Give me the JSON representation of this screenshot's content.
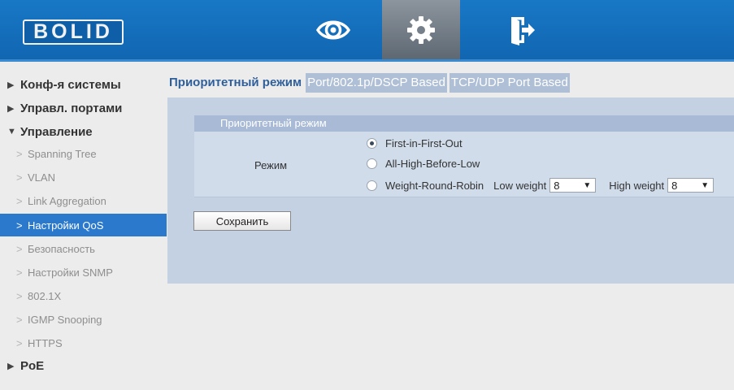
{
  "header": {
    "logo_text": "BOLID",
    "nav": [
      {
        "icon": "eye-icon"
      },
      {
        "icon": "gear-icon",
        "active": true
      },
      {
        "icon": "logout-icon"
      }
    ],
    "accent": "#1670bd"
  },
  "sidebar": {
    "groups": [
      {
        "arrow": "▶",
        "label": "Конф-я системы"
      },
      {
        "arrow": "▶",
        "label": "Управл. портами"
      },
      {
        "arrow": "▼",
        "label": "Управление"
      },
      {
        "arrow": "▶",
        "label": "PoE"
      }
    ],
    "items": [
      {
        "label": "Spanning Tree"
      },
      {
        "label": "VLAN"
      },
      {
        "label": "Link Aggregation"
      },
      {
        "label": "Настройки QoS",
        "active": true
      },
      {
        "label": "Безопасность"
      },
      {
        "label": "Настройки SNMP"
      },
      {
        "label": "802.1X"
      },
      {
        "label": "IGMP Snooping"
      },
      {
        "label": "HTTPS"
      }
    ],
    "chevron": ">",
    "active_color": "#2a79cd"
  },
  "tabs": [
    {
      "label": "Приоритетный режим",
      "active": true
    },
    {
      "label": "Port/802.1p/DSCP Based"
    },
    {
      "label": "TCP/UDP Port Based"
    }
  ],
  "section": {
    "title": "Приоритетный режим",
    "mode_label": "Режим",
    "options": [
      {
        "label": "First-in-First-Out",
        "checked": true
      },
      {
        "label": "All-High-Before-Low",
        "checked": false
      },
      {
        "label": "Weight-Round-Robin",
        "checked": false
      }
    ],
    "low_weight_label": "Low weight",
    "low_weight_value": "8",
    "high_weight_label": "High weight",
    "high_weight_value": "8"
  },
  "save_label": "Сохранить"
}
